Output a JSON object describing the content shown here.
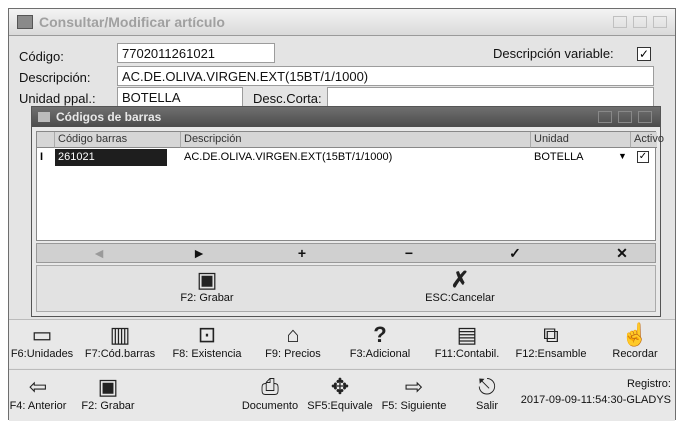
{
  "window": {
    "title": "Consultar/Modificar artículo"
  },
  "form": {
    "codigo_label": "Código:",
    "codigo_value": "7702011261021",
    "descripcion_variable_label": "Descripción variable:",
    "descripcion_variable_checked": "✓",
    "descripcion_label": "Descripción:",
    "descripcion_value": "AC.DE.OLIVA.VIRGEN.EXT(15BT/1/1000)",
    "unidad_label": "Unidad ppal.:",
    "unidad_value": "BOTELLA",
    "desc_corta_label": "Desc.Corta:",
    "desc_corta_value": ""
  },
  "barcodes": {
    "title": "Códigos de barras",
    "columns": [
      "Código barras",
      "Descripción",
      "Unidad",
      "Activo"
    ],
    "rows": [
      {
        "marker": "I",
        "codigo": "261021",
        "descripcion": "AC.DE.OLIVA.VIRGEN.EXT(15BT/1/1000)",
        "unidad": "BOTELLA",
        "activo": "✓"
      }
    ],
    "nav": {
      "prev": "◄",
      "next": "►",
      "add": "+",
      "remove": "−",
      "confirm": "✓",
      "delete": "✕"
    },
    "actions": {
      "save_label": "F2: Grabar",
      "cancel_label": "ESC:Cancelar"
    }
  },
  "toolbar1": [
    {
      "label": "F6:Unidades",
      "icon": "units-icon",
      "glyph": "▭"
    },
    {
      "label": "F7:Cód.barras",
      "icon": "barcode-icon",
      "glyph": "▥"
    },
    {
      "label": "F8: Existencia",
      "icon": "stock-icon",
      "glyph": "⊡"
    },
    {
      "label": "F9: Precios",
      "icon": "price-tag-icon",
      "glyph": "⌂"
    },
    {
      "label": "F3:Adicional",
      "icon": "question-icon",
      "glyph": "?"
    },
    {
      "label": "F11:Contabil.",
      "icon": "ledger-icon",
      "glyph": "▤"
    },
    {
      "label": "F12:Ensamble",
      "icon": "assembly-icon",
      "glyph": "⧉"
    },
    {
      "label": "Recordar",
      "icon": "hand-pointer-icon",
      "glyph": "☝"
    }
  ],
  "toolbar2": [
    {
      "label": "F4: Anterior",
      "icon": "arrow-left-icon",
      "glyph": "⇦"
    },
    {
      "label": "F2: Grabar",
      "icon": "save-icon",
      "glyph": "▣"
    },
    {
      "label": "Documento",
      "icon": "printer-icon",
      "glyph": "⎙"
    },
    {
      "label": "SF5:Equivale",
      "icon": "equivalence-icon",
      "glyph": "✥"
    },
    {
      "label": "F5: Siguiente",
      "icon": "arrow-right-icon",
      "glyph": "⇨"
    },
    {
      "label": "Salir",
      "icon": "exit-icon",
      "glyph": "⎋"
    }
  ],
  "registro": {
    "label": "Registro:",
    "value": "2017-09-09-11:54:30-GLADYS"
  }
}
